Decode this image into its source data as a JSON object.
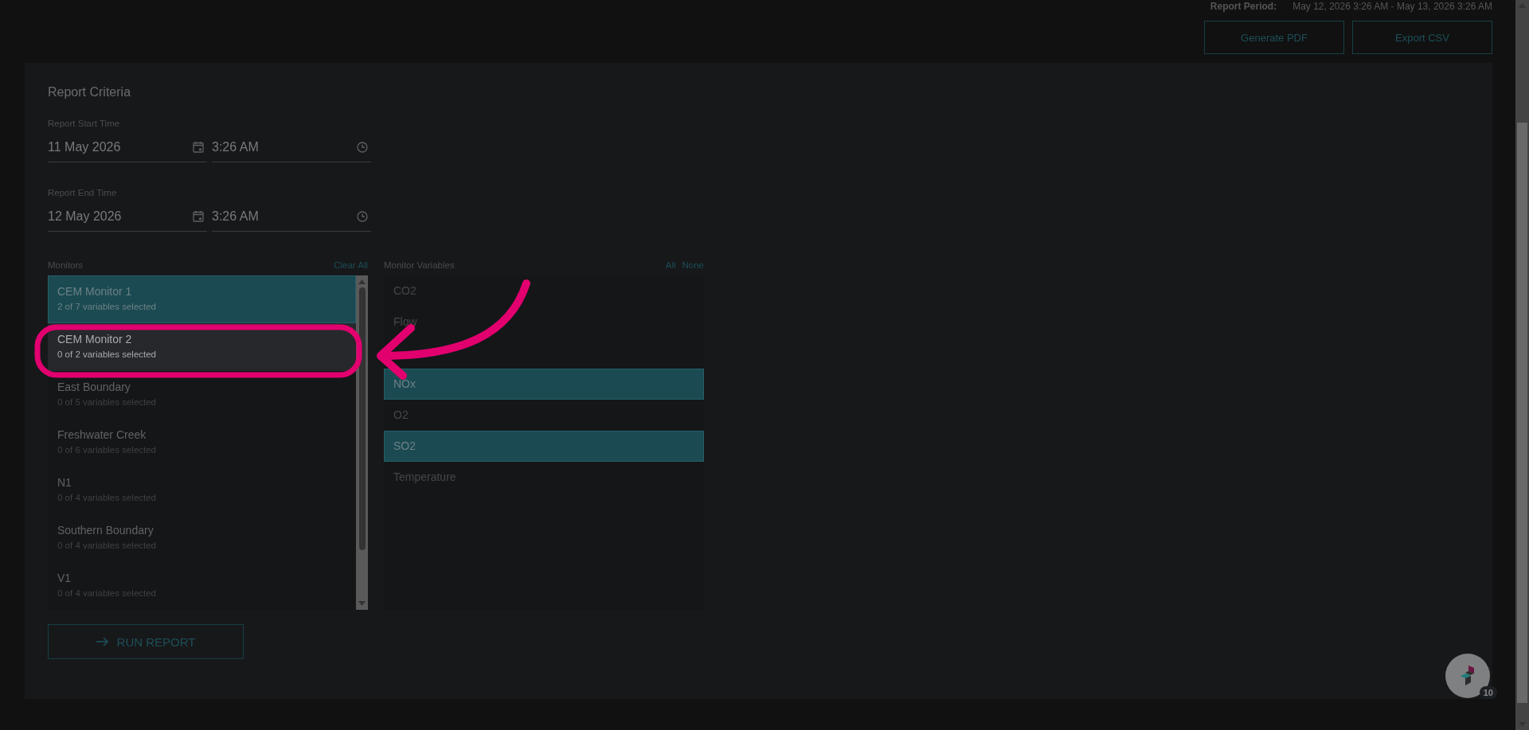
{
  "report_period": {
    "label": "Report Period:",
    "value": "May 12, 2026 3:26 AM - May 13, 2026 3:26 AM"
  },
  "actions": [
    "Generate PDF",
    "Export CSV"
  ],
  "criteria": {
    "title": "Report Criteria",
    "start": {
      "label": "Report Start Time",
      "date": "11 May 2026",
      "time": "3:26 AM"
    },
    "end": {
      "label": "Report End Time",
      "date": "12 May 2026",
      "time": "3:26 AM"
    }
  },
  "monitors": {
    "title": "Clear All",
    "label": "Monitors",
    "items": [
      {
        "name": "CEM Monitor 1",
        "summary": "2 of 7 variables selected",
        "selected": true,
        "highlighted": false
      },
      {
        "name": "CEM Monitor 2",
        "summary": "0 of 2 variables selected",
        "selected": false,
        "highlighted": true
      },
      {
        "name": "East Boundary",
        "summary": "0 of 5 variables selected",
        "selected": false,
        "highlighted": false
      },
      {
        "name": "Freshwater Creek",
        "summary": "0 of 6 variables selected",
        "selected": false,
        "highlighted": false
      },
      {
        "name": "N1",
        "summary": "0 of 4 variables selected",
        "selected": false,
        "highlighted": false
      },
      {
        "name": "Southern Boundary",
        "summary": "0 of 4 variables selected",
        "selected": false,
        "highlighted": false
      },
      {
        "name": "V1",
        "summary": "0 of 4 variables selected",
        "selected": false,
        "highlighted": false
      }
    ]
  },
  "variables": {
    "label": "Monitor Variables",
    "all": "All",
    "none": "None",
    "items": [
      {
        "label": "CO2",
        "selected": false
      },
      {
        "label": "Flow",
        "selected": false
      },
      {
        "selected": false
      },
      {
        "label": "NOx",
        "selected": true
      },
      {
        "label": "O2",
        "selected": false
      },
      {
        "label": "SO2",
        "selected": true
      },
      {
        "label": "Temperature",
        "selected": false
      }
    ]
  },
  "run_button": "RUN REPORT",
  "notification_badge": "10"
}
